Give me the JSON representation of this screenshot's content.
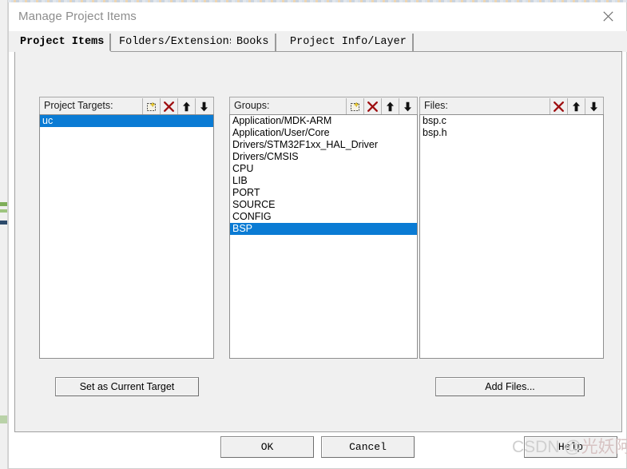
{
  "window": {
    "title": "Manage Project Items",
    "close_icon": "close-icon"
  },
  "tabs": [
    {
      "label": "Project Items",
      "active": true
    },
    {
      "label": "Folders/Extensions",
      "active": false
    },
    {
      "label": "Books",
      "active": false
    },
    {
      "label": "Project Info/Layer",
      "active": false
    }
  ],
  "columns": {
    "targets": {
      "header": "Project Targets:",
      "tools": [
        "new-item-icon",
        "delete-icon",
        "move-up-icon",
        "move-down-icon"
      ],
      "items": [
        {
          "label": "uc",
          "selected": true
        }
      ],
      "action_button": "Set as Current Target"
    },
    "groups": {
      "header": "Groups:",
      "tools": [
        "new-item-icon",
        "delete-icon",
        "move-up-icon",
        "move-down-icon"
      ],
      "items": [
        {
          "label": "Application/MDK-ARM",
          "selected": false
        },
        {
          "label": "Application/User/Core",
          "selected": false
        },
        {
          "label": "Drivers/STM32F1xx_HAL_Driver",
          "selected": false
        },
        {
          "label": "Drivers/CMSIS",
          "selected": false
        },
        {
          "label": "CPU",
          "selected": false
        },
        {
          "label": "LIB",
          "selected": false
        },
        {
          "label": "PORT",
          "selected": false
        },
        {
          "label": "SOURCE",
          "selected": false
        },
        {
          "label": "CONFIG",
          "selected": false
        },
        {
          "label": "BSP",
          "selected": true
        }
      ]
    },
    "files": {
      "header": "Files:",
      "tools": [
        "delete-icon",
        "move-up-icon",
        "move-down-icon"
      ],
      "items": [
        {
          "label": "bsp.c",
          "selected": false
        },
        {
          "label": "bsp.h",
          "selected": false
        }
      ],
      "action_button": "Add Files..."
    }
  },
  "footer": {
    "ok": "OK",
    "cancel": "Cancel",
    "help": "Help"
  },
  "watermark": {
    "prefix": "CSDN @",
    "name": "光妖阿"
  },
  "colors": {
    "selection_blue": "#0a7bd4",
    "dialog_face": "#f0f0f0",
    "delete_red": "#9e0f11",
    "title_gray": "#8d8d8d"
  }
}
